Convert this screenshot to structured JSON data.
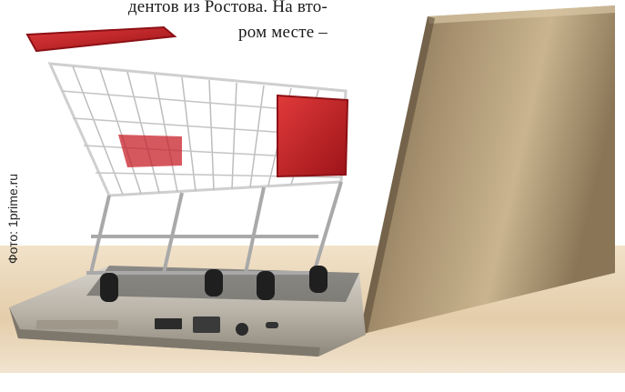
{
  "article": {
    "line1": "дентов из Ростова. На вто-",
    "line2": "ром месте –"
  },
  "photo": {
    "credit": "Фото: 1prime.ru",
    "subject_icons": [
      "shopping-cart-icon",
      "laptop-icon"
    ],
    "colors": {
      "cart_accent": "#c8202a",
      "laptop_lid": "#8f7a5a",
      "desk": "#e8d3b4"
    }
  }
}
